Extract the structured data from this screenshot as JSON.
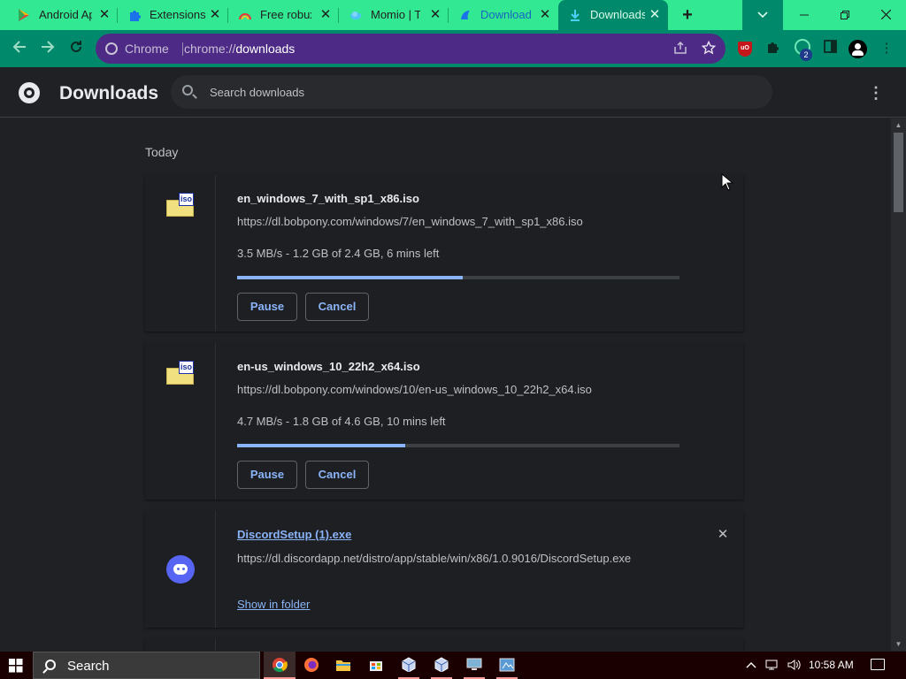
{
  "tabs": [
    {
      "title": "Android Ap",
      "icon": "google-play-icon"
    },
    {
      "title": "Extensions",
      "icon": "puzzle-icon"
    },
    {
      "title": "Free robux",
      "icon": "rainbow-icon"
    },
    {
      "title": "Momio | TI",
      "icon": "cloud-icon"
    },
    {
      "title": "Downloads",
      "icon": "mangled-logo-icon"
    },
    {
      "title": "Downloads",
      "icon": "download-icon"
    }
  ],
  "omnibox": {
    "chip": "Chrome",
    "url_scheme": "chrome://",
    "url_host": "downloads"
  },
  "extension_badge": "2",
  "header": {
    "title": "Downloads",
    "search_placeholder": "Search downloads"
  },
  "day_label": "Today",
  "downloads": [
    {
      "name": "en_windows_7_with_sp1_x86.iso",
      "url": "https://dl.bobpony.com/windows/7/en_windows_7_with_sp1_x86.iso",
      "status": "3.5 MB/s - 1.2 GB of 2.4 GB, 6 mins left",
      "progress_fraction": 0.51,
      "icon_tag": "iso",
      "pause_label": "Pause",
      "cancel_label": "Cancel"
    },
    {
      "name": "en-us_windows_10_22h2_x64.iso",
      "url": "https://dl.bobpony.com/windows/10/en-us_windows_10_22h2_x64.iso",
      "status": "4.7 MB/s - 1.8 GB of 4.6 GB, 10 mins left",
      "progress_fraction": 0.38,
      "icon_tag": "iso",
      "pause_label": "Pause",
      "cancel_label": "Cancel"
    },
    {
      "name": "DiscordSetup (1).exe",
      "url": "https://dl.discordapp.net/distro/app/stable/win/x86/1.0.9016/DiscordSetup.exe",
      "show_in_folder_label": "Show in folder"
    }
  ],
  "taskbar": {
    "search_label": "Search",
    "clock": "10:58 AM"
  },
  "colors": {
    "tabstrip": "#33e893",
    "toolbar": "#00896b",
    "omnibox": "#4d2a85",
    "accent_link": "#8ab4f8",
    "page_bg": "#202124"
  }
}
